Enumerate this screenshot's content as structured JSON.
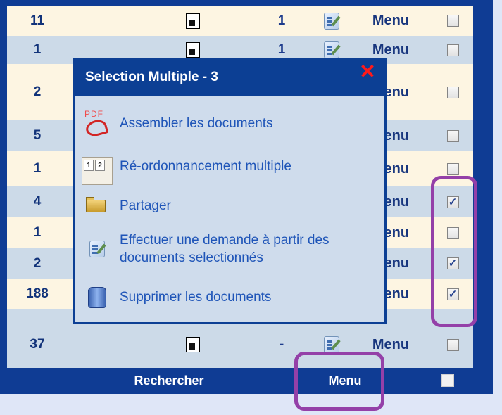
{
  "rows": [
    {
      "num": "11",
      "count": "1",
      "menu": "Menu",
      "checked": false,
      "bg": "cream"
    },
    {
      "num": "1",
      "count": "1",
      "menu": "Menu",
      "checked": false,
      "bg": "blue"
    },
    {
      "num": "2",
      "count": "",
      "menu": "Menu",
      "checked": false,
      "bg": "cream"
    },
    {
      "num": "5",
      "count": "",
      "menu": "Menu",
      "checked": false,
      "bg": "blue"
    },
    {
      "num": "1",
      "count": "",
      "menu": "Menu",
      "checked": false,
      "bg": "cream"
    },
    {
      "num": "4",
      "count": "",
      "menu": "Menu",
      "checked": true,
      "bg": "blue"
    },
    {
      "num": "1",
      "count": "",
      "menu": "Menu",
      "checked": false,
      "bg": "cream"
    },
    {
      "num": "2",
      "count": "",
      "menu": "Menu",
      "checked": true,
      "bg": "blue"
    },
    {
      "num": "188",
      "count": "",
      "menu": "Menu",
      "checked": true,
      "bg": "cream"
    },
    {
      "num": "37",
      "count": "-",
      "menu": "Menu",
      "checked": false,
      "bg": "blue"
    }
  ],
  "footer": {
    "search_label": "Rechercher",
    "menu_label": "Menu"
  },
  "popup": {
    "title": "Selection Multiple - 3",
    "close_glyph": "✕",
    "actions": [
      {
        "label": "Assembler les documents",
        "icon": "pdf-icon"
      },
      {
        "label": "Ré-ordonnancement multiple",
        "icon": "reorder-icon"
      },
      {
        "label": "Partager",
        "icon": "folder-icon"
      },
      {
        "label": "Effectuer une demande à partir des documents selectionnés",
        "icon": "request-icon"
      },
      {
        "label": "Supprimer les documents",
        "icon": "trash-icon"
      }
    ]
  },
  "colors": {
    "accent": "#0f3c94",
    "highlight": "#9440a8",
    "link": "#1f55b8",
    "close": "#ff1a1a"
  }
}
